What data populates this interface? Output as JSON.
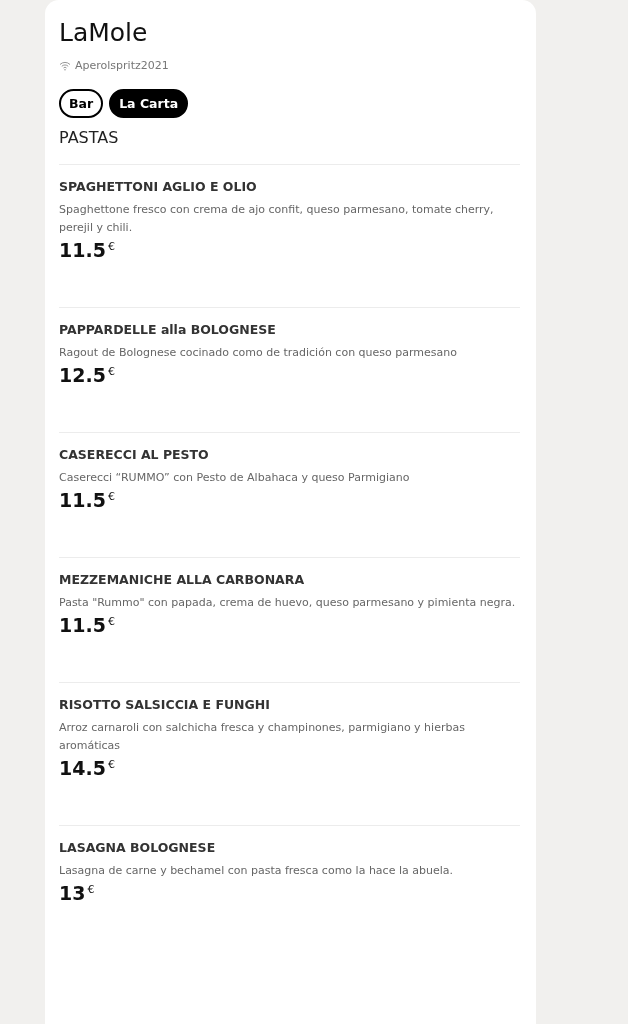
{
  "venue": {
    "name": "LaMole",
    "wifi": "Aperolspritz2021"
  },
  "tabs": [
    {
      "label": "Bar",
      "selected": false
    },
    {
      "label": "La Carta",
      "selected": true
    }
  ],
  "section": "PASTAS",
  "items": [
    {
      "name": "SPAGHETTONI AGLIO E OLIO",
      "description": "Spaghettone fresco con crema de ajo confit, queso parmesano, tomate cherry, perejil y chili.",
      "price": "11.5",
      "currency": "€"
    },
    {
      "name": "PAPPARDELLE alla BOLOGNESE",
      "description": "Ragout de Bolognese cocinado como de tradición con queso parmesano",
      "price": "12.5",
      "currency": "€"
    },
    {
      "name": "CASERECCI AL PESTO",
      "description": "Caserecci “RUMMO” con Pesto de Albahaca y queso Parmigiano",
      "price": "11.5",
      "currency": "€"
    },
    {
      "name": "MEZZEMANICHE ALLA CARBONARA",
      "description": "Pasta \"Rummo\" con papada, crema de huevo, queso parmesano y pimienta negra.",
      "price": "11.5",
      "currency": "€"
    },
    {
      "name": "RISOTTO SALSICCIA E FUNGHI",
      "description": "Arroz carnaroli con salchicha fresca y champinones, parmigiano y hierbas aromáticas",
      "price": "14.5",
      "currency": "€"
    },
    {
      "name": "LASAGNA BOLOGNESE",
      "description": "Lasagna de carne y bechamel con pasta fresca como la hace la abuela.",
      "price": "13",
      "currency": "€"
    }
  ]
}
